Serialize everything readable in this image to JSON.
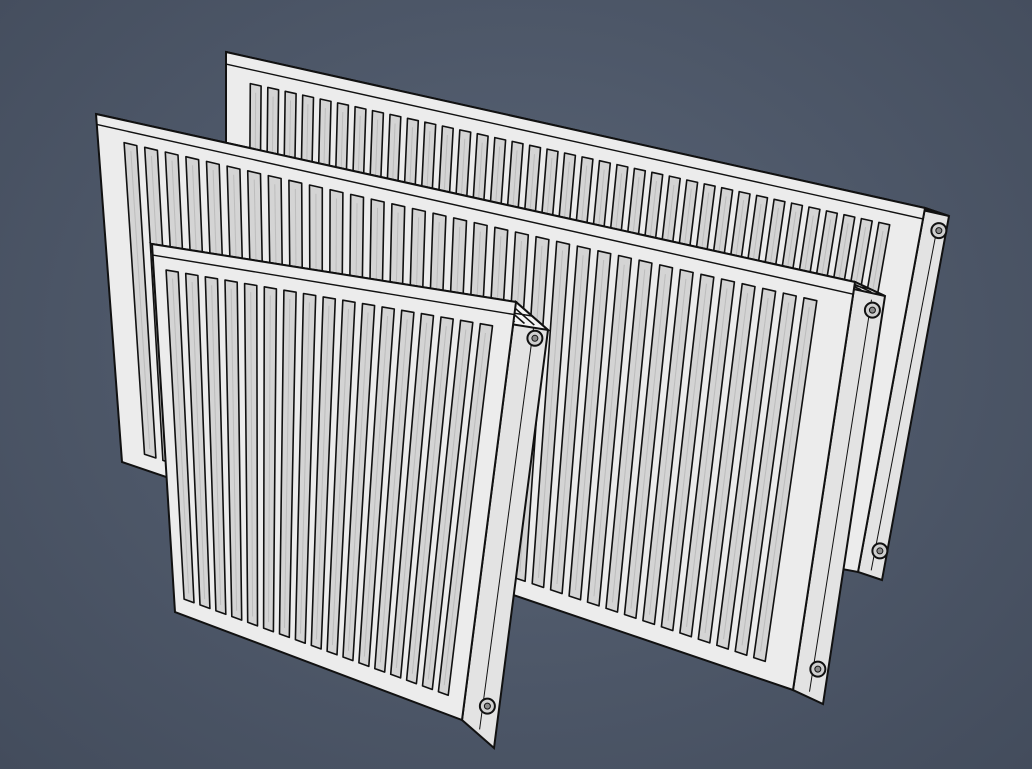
{
  "scene": {
    "subject": "panel radiators",
    "render_style": "cel-shaded white with black outlines",
    "colors": {
      "background": "#4d5768",
      "panel_front": "#ececec",
      "panel_shade": "#d4d4d4",
      "panel_side": "#e3e3e3",
      "top_grille": "#f4f4f4",
      "outline": "#111111"
    },
    "radiators": [
      {
        "id": "back",
        "flutes": 37
      },
      {
        "id": "middle",
        "flutes": 34
      },
      {
        "id": "front",
        "flutes": 17
      }
    ]
  }
}
